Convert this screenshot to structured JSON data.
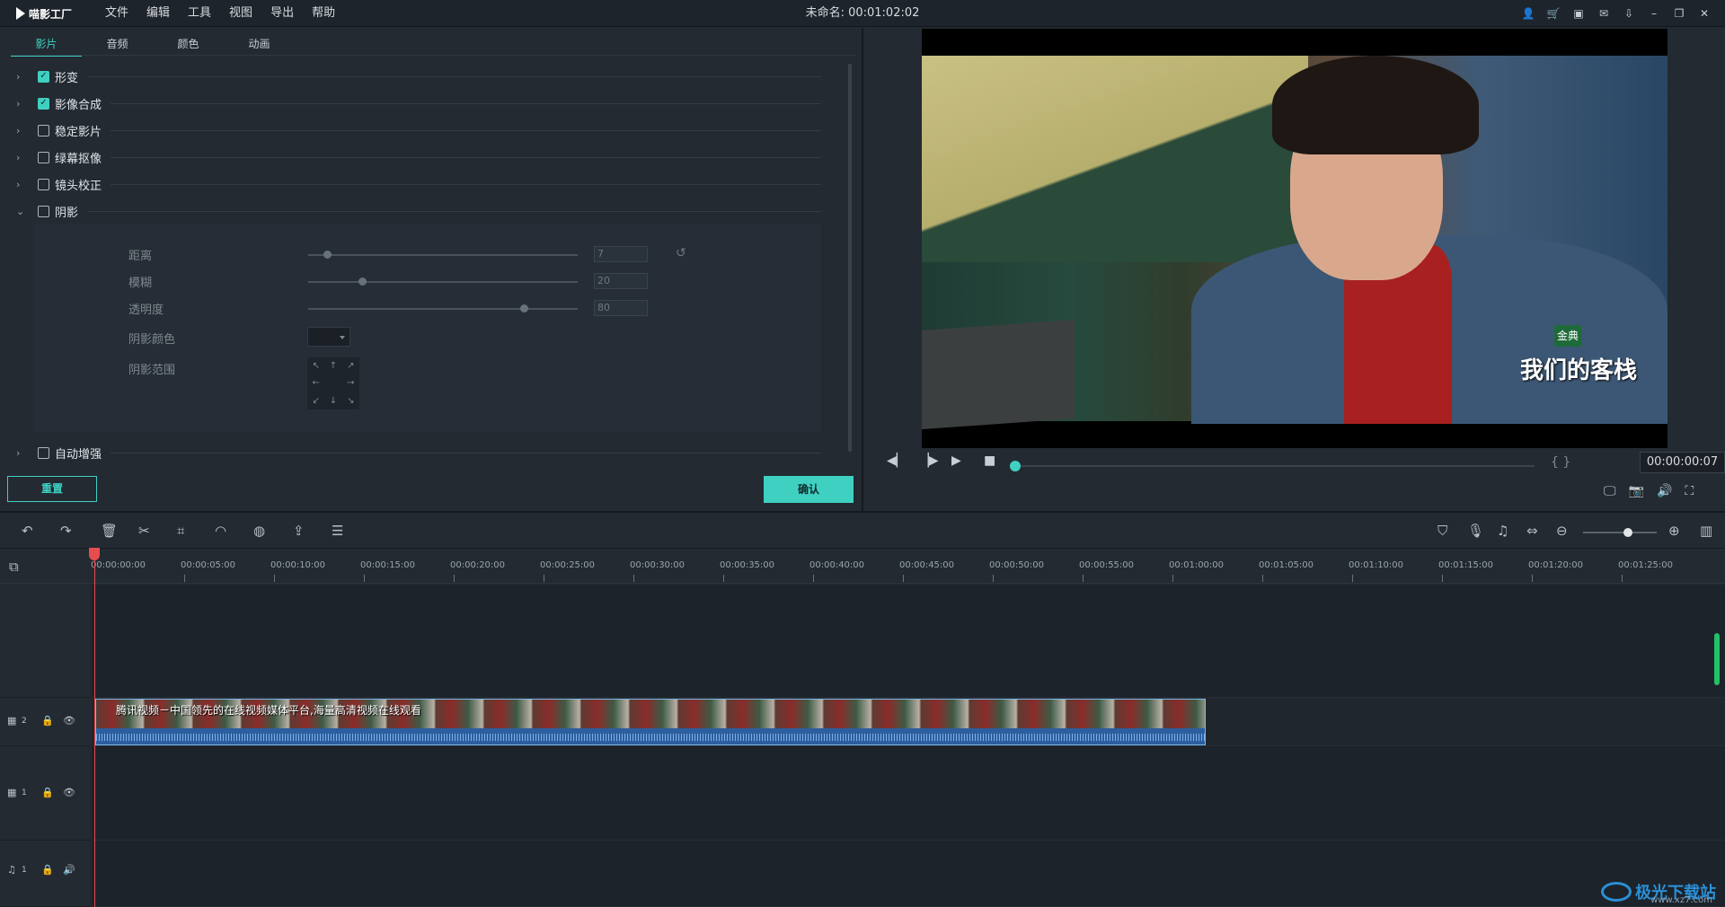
{
  "app": {
    "logo_text": "喵影工厂",
    "menus": [
      "文件",
      "编辑",
      "工具",
      "视图",
      "导出",
      "帮助"
    ],
    "doc_title": "未命名: 00:01:02:02"
  },
  "panel": {
    "tabs": [
      "影片",
      "音频",
      "颜色",
      "动画"
    ],
    "active_tab": "影片",
    "sections": [
      {
        "label": "形变",
        "checked": true,
        "expanded": false
      },
      {
        "label": "影像合成",
        "checked": true,
        "expanded": false
      },
      {
        "label": "稳定影片",
        "checked": false,
        "expanded": false
      },
      {
        "label": "绿幕抠像",
        "checked": false,
        "expanded": false
      },
      {
        "label": "镜头校正",
        "checked": false,
        "expanded": false
      },
      {
        "label": "阴影",
        "checked": false,
        "expanded": true
      },
      {
        "label": "自动增强",
        "checked": false,
        "expanded": false
      }
    ],
    "shadow": {
      "distance_label": "距离",
      "distance_value": "7",
      "distance_fraction": 0.07,
      "blur_label": "模糊",
      "blur_value": "20",
      "blur_fraction": 0.2,
      "opacity_label": "透明度",
      "opacity_value": "80",
      "opacity_fraction": 0.8,
      "color_label": "阴影颜色",
      "range_label": "阴影范围"
    },
    "reset_button": "重置",
    "ok_button": "确认"
  },
  "preview": {
    "timecode": "00:00:00:07",
    "watermark": "我们的客栈",
    "watermark_badge": "金典",
    "progress_fraction": 0.0
  },
  "timeline": {
    "ruler": [
      "00:00:00:00",
      "00:00:05:00",
      "00:00:10:00",
      "00:00:15:00",
      "00:00:20:00",
      "00:00:25:00",
      "00:00:30:00",
      "00:00:35:00",
      "00:00:40:00",
      "00:00:45:00",
      "00:00:50:00",
      "00:00:55:00",
      "00:01:00:00",
      "00:01:05:00",
      "00:01:10:00",
      "00:01:15:00",
      "00:01:20:00",
      "00:01:25:00"
    ],
    "tracks": [
      {
        "name": "video-track-2",
        "number": "2"
      },
      {
        "name": "video-track-1",
        "number": "1"
      },
      {
        "name": "audio-track-1",
        "number": "1"
      }
    ],
    "clip_title": "腾讯视频－中国领先的在线视频媒体平台,海量高清视频在线观看"
  },
  "brand": {
    "name": "极光下载站",
    "url": "www.xz7.com"
  },
  "colors": {
    "accent": "#3fd0c2",
    "playhead": "#e84c4c",
    "clip_border": "#7fb8e6",
    "waveform": "#2c5ea0"
  }
}
